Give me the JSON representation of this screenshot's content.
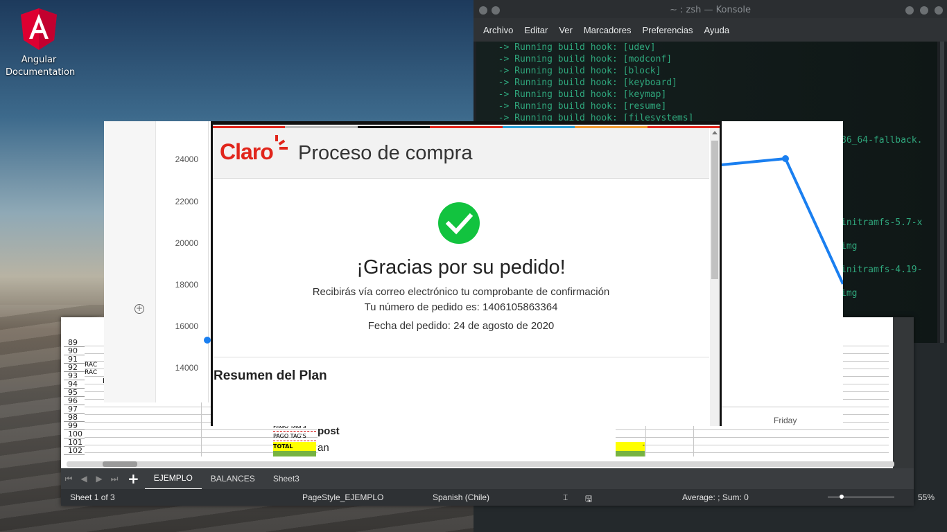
{
  "desktop": {
    "icon_label_line1": "Angular",
    "icon_label_line2": "Documentation"
  },
  "konsole": {
    "title": "~ : zsh — Konsole",
    "menu": [
      "Archivo",
      "Editar",
      "Ver",
      "Marcadores",
      "Preferencias",
      "Ayuda"
    ],
    "lines": [
      "  -> Running build hook: [udev]",
      "  -> Running build hook: [modconf]",
      "  -> Running build hook: [block]",
      "  -> Running build hook: [keyboard]",
      "  -> Running build hook: [keymap]",
      "  -> Running build hook: [resume]",
      "  -> Running build hook: [filesystems]"
    ],
    "tail_lines": [
      "86_64-fallback.",
      "initramfs-5.7-x",
      "img",
      "initramfs-4.19-",
      "img"
    ]
  },
  "chart": {
    "y_ticks": [
      "24000",
      "22000",
      "20000",
      "18000",
      "16000",
      "14000"
    ],
    "x_label_visible": "Friday",
    "line_color": "#1a7ff0"
  },
  "dialog": {
    "brand": "Claro",
    "title": "Proceso de compra",
    "thanks": "¡Gracias por su pedido!",
    "line1": "Recibirás vía correo electrónico tu comprobante de confirmación",
    "line2": "Tu número de pedido es: 1406105863364",
    "line3": "Fecha del pedido: 24 de agosto de 2020",
    "section": "Resumen del Plan",
    "under_bold": "post",
    "under_text": "an",
    "stripe_colors": [
      "#e1261c",
      "#bdbdbd",
      "#111111",
      "#e1261c",
      "#2a9fd6",
      "#f29b33",
      "#e1261c"
    ]
  },
  "calc": {
    "row_numbers": [
      "89",
      "90",
      "91",
      "92",
      "93",
      "94",
      "95",
      "96",
      "97",
      "98",
      "99",
      "100",
      "101",
      "102"
    ],
    "rac": [
      "RAC",
      "RAC"
    ],
    "rac_suffix": "nt",
    "tag_label": "PAGO TAG'S",
    "total_label": "TOTAL",
    "dash": "-",
    "tabs": [
      "EJEMPLO",
      "BALANCES",
      "Sheet3"
    ],
    "active_tab": "EJEMPLO",
    "status": {
      "sheet": "Sheet 1 of 3",
      "page_style": "PageStyle_EJEMPLO",
      "language": "Spanish (Chile)",
      "summary": "Average: ; Sum: 0",
      "zoom": "55%"
    }
  }
}
